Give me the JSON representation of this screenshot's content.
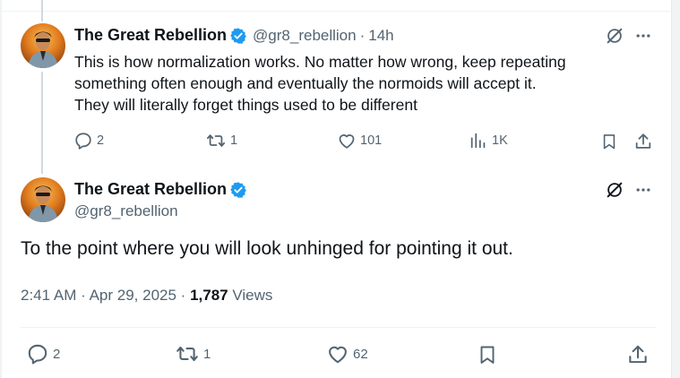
{
  "reply_tweet": {
    "display_name": "The Great Rebellion",
    "handle": "@gr8_rebellion",
    "separator": "·",
    "time": "14h",
    "text_lines": [
      "This is how normalization works. No matter how wrong, keep repeating",
      "something often enough and eventually the normoids will accept it.",
      "They will literally forget things used to be different"
    ],
    "actions": {
      "replies": "2",
      "reposts": "1",
      "likes": "101",
      "views": "1K"
    }
  },
  "main_tweet": {
    "display_name": "The Great Rebellion",
    "handle": "@gr8_rebellion",
    "text": "To the point where you will look unhinged for pointing it out.",
    "time": "2:41 AM",
    "separator1": "·",
    "date": "Apr 29, 2025",
    "separator2": "·",
    "views_count": "1,787",
    "views_label": "Views",
    "actions": {
      "replies": "2",
      "reposts": "1",
      "likes": "62"
    }
  },
  "colors": {
    "verified": "#1d9bf0",
    "secondary_text": "#536471",
    "primary_text": "#0f1419"
  },
  "icons": [
    "verified-badge-icon",
    "grok-icon",
    "more-icon",
    "reply-icon",
    "repost-icon",
    "like-icon",
    "views-icon",
    "bookmark-icon",
    "share-icon"
  ]
}
